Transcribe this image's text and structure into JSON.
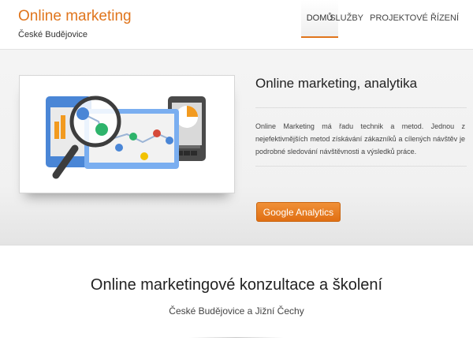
{
  "brand": {
    "title": "Online marketing",
    "subtitle": "České Budějovice"
  },
  "nav": {
    "items": [
      "DOMŮ",
      "SLUŽBY",
      "PROJEKTOVÉ ŘÍZENÍ"
    ],
    "active": "DOMŮ"
  },
  "hero": {
    "title": "Online marketing, analytika",
    "text": "Online Marketing má řadu technik a metod. Jednou z nejefektivnějších metod získávání zákazníků a cílených návštěv je podrobné sledování návštěvnosti a výsledků práce.",
    "button_label": "Google Analytics",
    "illustration": "analytics-illustration"
  },
  "section": {
    "title": "Online marketingové konzultace a školení",
    "subtitle": "České Budějovice a Jižní Čechy"
  },
  "colors": {
    "accent": "#e0751c",
    "button": "#e8801f",
    "text": "#333333"
  }
}
